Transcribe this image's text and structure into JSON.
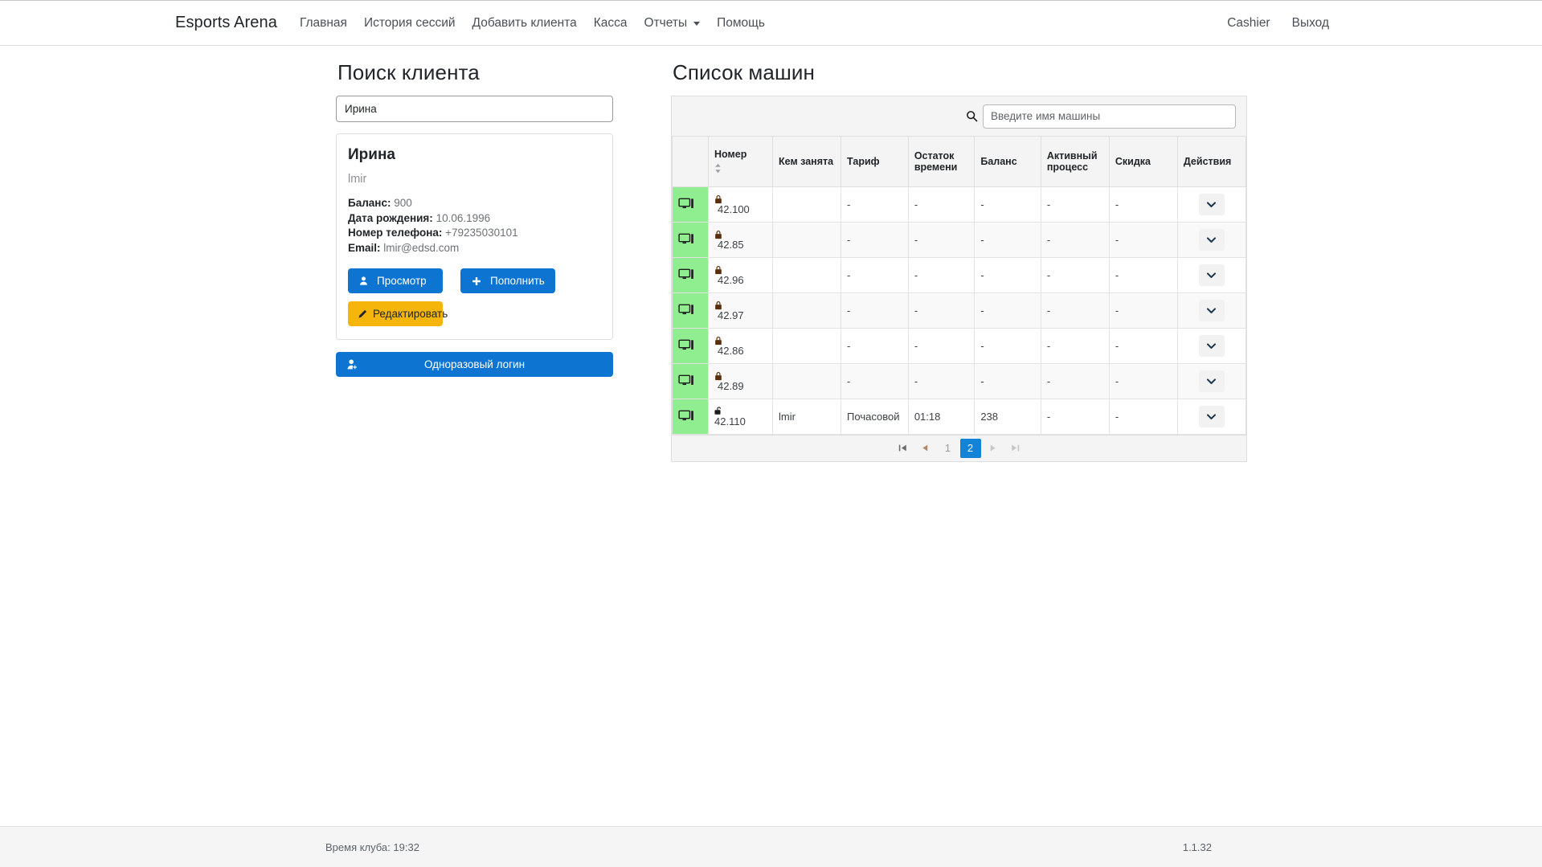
{
  "navbar": {
    "brand": "Esports Arena",
    "links": [
      {
        "label": "Главная",
        "icon": null
      },
      {
        "label": "История сессий",
        "icon": null
      },
      {
        "label": "Добавить клиента",
        "icon": null
      },
      {
        "label": "Касса",
        "icon": null
      },
      {
        "label": "Отчеты",
        "icon": "chevron-down-icon"
      },
      {
        "label": "Помощь",
        "icon": null
      }
    ],
    "user": "Cashier",
    "logout": "Выход"
  },
  "client_search": {
    "title": "Поиск клиента",
    "input_value": "Ирина",
    "input_placeholder": ""
  },
  "client_card": {
    "name": "Ирина",
    "login": "lmir",
    "fields": [
      {
        "label": "Баланс:",
        "value": "900"
      },
      {
        "label": "Дата рождения:",
        "value": "10.06.1996"
      },
      {
        "label": "Номер телефона:",
        "value": "+79235030101"
      },
      {
        "label": "Email:",
        "value": "lmir@edsd.com"
      }
    ],
    "buttons": {
      "view": "Просмотр",
      "topup": "Пополнить",
      "edit": "Редактировать",
      "onetime_login": "Одноразовый логин"
    }
  },
  "machines": {
    "title": "Список машин",
    "search_placeholder": "Введите имя машины",
    "search_value": "",
    "columns": [
      {
        "key": "status",
        "label": "",
        "sortable": false
      },
      {
        "key": "number",
        "label": "Номер",
        "sortable": true
      },
      {
        "key": "occupied_by",
        "label": "Кем занята",
        "sortable": false
      },
      {
        "key": "tariff",
        "label": "Тариф",
        "sortable": false
      },
      {
        "key": "time_left",
        "label": "Остаток времени",
        "sortable": false
      },
      {
        "key": "balance",
        "label": "Баланс",
        "sortable": false
      },
      {
        "key": "active_process",
        "label": "Активный процесс",
        "sortable": false
      },
      {
        "key": "discount",
        "label": "Скидка",
        "sortable": false
      },
      {
        "key": "actions",
        "label": "Действия",
        "sortable": false
      }
    ],
    "rows": [
      {
        "locked": true,
        "number": "42.100",
        "occupied_by": "",
        "tariff": "-",
        "time_left": "-",
        "balance": "-",
        "active_process": "-",
        "discount": "-"
      },
      {
        "locked": true,
        "number": "42.85",
        "occupied_by": "",
        "tariff": "-",
        "time_left": "-",
        "balance": "-",
        "active_process": "-",
        "discount": "-"
      },
      {
        "locked": true,
        "number": "42.96",
        "occupied_by": "",
        "tariff": "-",
        "time_left": "-",
        "balance": "-",
        "active_process": "-",
        "discount": "-"
      },
      {
        "locked": true,
        "number": "42.97",
        "occupied_by": "",
        "tariff": "-",
        "time_left": "-",
        "balance": "-",
        "active_process": "-",
        "discount": "-"
      },
      {
        "locked": true,
        "number": "42.86",
        "occupied_by": "",
        "tariff": "-",
        "time_left": "-",
        "balance": "-",
        "active_process": "-",
        "discount": "-"
      },
      {
        "locked": true,
        "number": "42.89",
        "occupied_by": "",
        "tariff": "-",
        "time_left": "-",
        "balance": "-",
        "active_process": "-",
        "discount": "-"
      },
      {
        "locked": false,
        "number": "42.110",
        "occupied_by": "lmir",
        "tariff": "Почасовой",
        "time_left": "01:18",
        "balance": "238",
        "active_process": "-",
        "discount": "-"
      }
    ],
    "pagination": {
      "first": "⏮",
      "prev": "◀",
      "pages": [
        "1",
        "2"
      ],
      "current": "2",
      "next": "▶",
      "last": "⏭"
    }
  },
  "footer": {
    "club_time": "Время клуба: 19:32",
    "version": "1.1.32"
  },
  "colors": {
    "primary": "#0d75d1",
    "warning": "#f5b50a",
    "status_free": "#90ee90",
    "pagination_active": "#1383d8"
  }
}
